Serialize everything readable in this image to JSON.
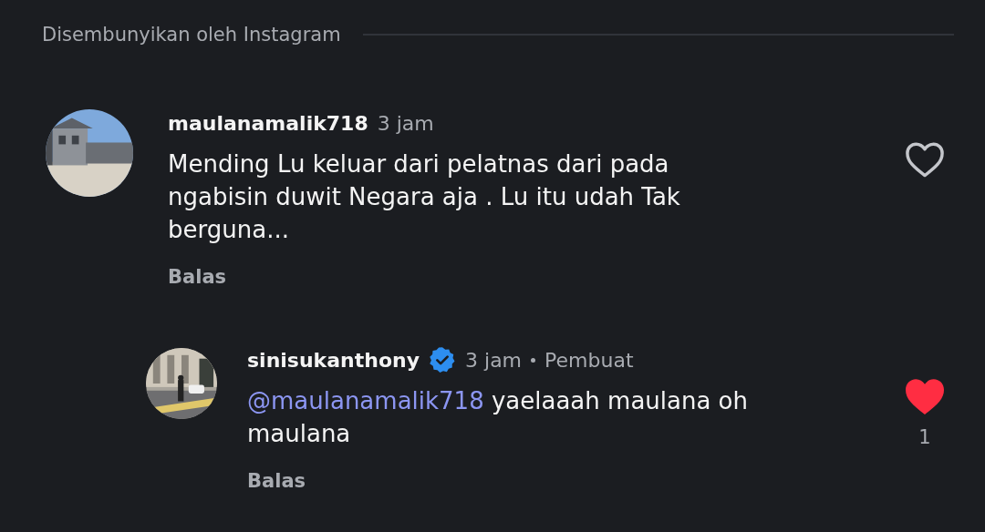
{
  "section_header": {
    "label": "Disembunyikan oleh Instagram"
  },
  "comments": [
    {
      "username": "maulanamalik718",
      "verified": false,
      "time": "3 jam",
      "text": "Mending Lu keluar dari pelatnas dari pada ngabisin duwit Negara aja . Lu itu udah Tak berguna...",
      "reply_label": "Balas",
      "liked": false,
      "children": [
        {
          "username": "sinisukanthony",
          "verified": true,
          "time": "3 jam",
          "role": "Pembuat",
          "mention": "@maulanamalik718",
          "text": "yaelaaah maulana oh maulana",
          "reply_label": "Balas",
          "liked": true,
          "like_count": "1"
        }
      ]
    }
  ]
}
